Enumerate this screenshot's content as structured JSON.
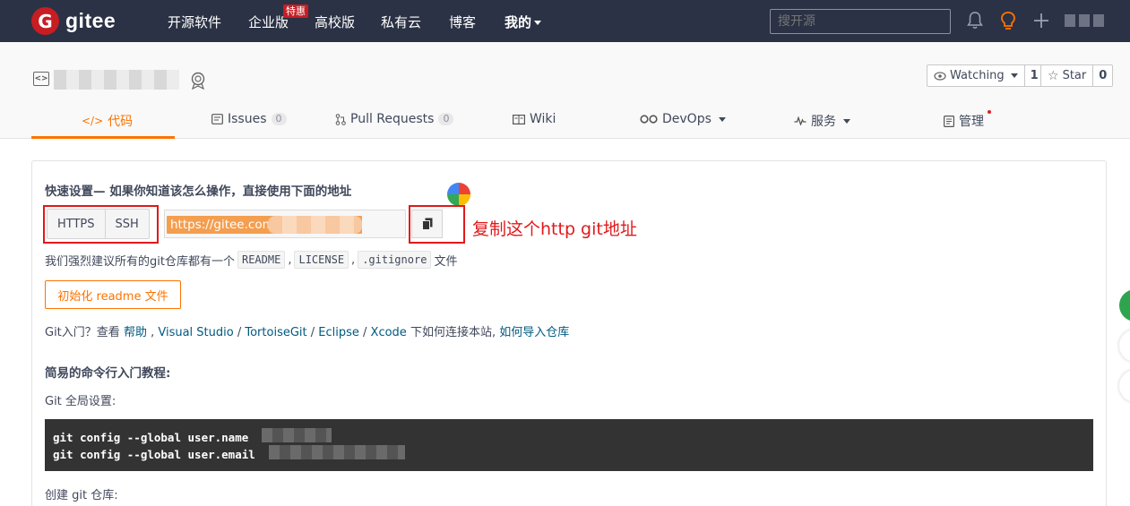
{
  "nav": {
    "brand": "gitee",
    "logo_letter": "G",
    "items": [
      "开源软件",
      "企业版",
      "高校版",
      "私有云",
      "博客",
      "我的"
    ],
    "badge": "特惠",
    "search_placeholder": "搜开源"
  },
  "repo": {
    "watch": {
      "label": "Watching",
      "count": "1"
    },
    "star": {
      "label": "Star",
      "count": "0"
    },
    "tabs": [
      {
        "label": "代码",
        "icon": "code-icon",
        "active": true
      },
      {
        "label": "Issues",
        "count": "0",
        "icon": "issues-icon"
      },
      {
        "label": "Pull Requests",
        "count": "0",
        "icon": "pull-request-icon"
      },
      {
        "label": "Wiki",
        "icon": "wiki-icon"
      },
      {
        "label": "DevOps",
        "icon": "devops-icon"
      },
      {
        "label": "服务",
        "icon": "service-icon"
      },
      {
        "label": "管理",
        "icon": "manage-icon"
      }
    ]
  },
  "quick_setup": {
    "title": "快速设置— 如果你知道该怎么操作，直接使用下面的地址",
    "protocols": [
      "HTTPS",
      "SSH"
    ],
    "url": "https://gitee.com/",
    "annotation": "复制这个http git地址",
    "suggest_prefix": "我们强烈建议所有的git仓库都有一个",
    "files": [
      "README",
      "LICENSE",
      ".gitignore"
    ],
    "suggest_suffix": "文件",
    "init_button": "初始化 readme 文件",
    "help_prefix": "Git入门？查看",
    "help_links": [
      "帮助",
      "Visual Studio",
      "TortoiseGit",
      "Eclipse",
      "Xcode"
    ],
    "help_mid": "下如何连接本站,",
    "help_last_link": "如何导入仓库",
    "cli_title": "简易的命令行入门教程:",
    "global_title": "Git 全局设置:",
    "code_lines": [
      "git config --global user.name",
      "git config --global user.email"
    ],
    "create_title": "创建 git 仓库:"
  },
  "colors": {
    "nav_bg": "#2b3245",
    "accent": "#fe7300",
    "brand_red": "#c71d23",
    "annotation_red": "#e0191b"
  }
}
